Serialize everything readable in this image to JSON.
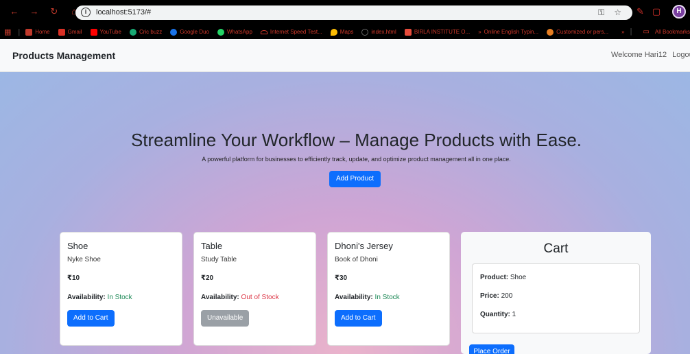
{
  "browser": {
    "url": "localhost:5173/#",
    "bookmarks": [
      "Home",
      "Gmail",
      "YouTube",
      "Cric buzz",
      "Google Duo",
      "WhatsApp",
      "Internet Speed Test...",
      "Maps",
      "index.html",
      "BIRLA INSTITUTE O...",
      "Online English Typin...",
      "Customized or pers..."
    ],
    "all_bookmarks": "All Bookmarks",
    "profile_initial": "H"
  },
  "navbar": {
    "brand": "Products Management",
    "welcome": "Welcome Hari12",
    "logout": "Logout"
  },
  "hero": {
    "title": "Streamline Your Workflow – Manage Products with Ease.",
    "subtitle": "A powerful platform for businesses to efficiently track, update, and optimize product management all in one place.",
    "add_button": "Add Product"
  },
  "products": [
    {
      "name": "Shoe",
      "description": "Nyke Shoe",
      "price": "₹10",
      "availability_label": "Availability:",
      "availability": "In Stock",
      "button": "Add to Cart"
    },
    {
      "name": "Table",
      "description": "Study Table",
      "price": "₹20",
      "availability_label": "Availability:",
      "availability": "Out of Stock",
      "button": "Unavailable"
    },
    {
      "name": "Dhoni's Jersey",
      "description": "Book of Dhoni",
      "price": "₹30",
      "availability_label": "Availability:",
      "availability": "In Stock",
      "button": "Add to Cart"
    }
  ],
  "cart": {
    "title": "Cart",
    "product_label": "Product:",
    "product": "Shoe",
    "price_label": "Price:",
    "price": "200",
    "quantity_label": "Quantity:",
    "quantity": "1",
    "place_order": "Place Order"
  },
  "colors": {
    "primary": "#0d6efd",
    "in_stock": "#198754",
    "out_of_stock": "#dc3545"
  }
}
